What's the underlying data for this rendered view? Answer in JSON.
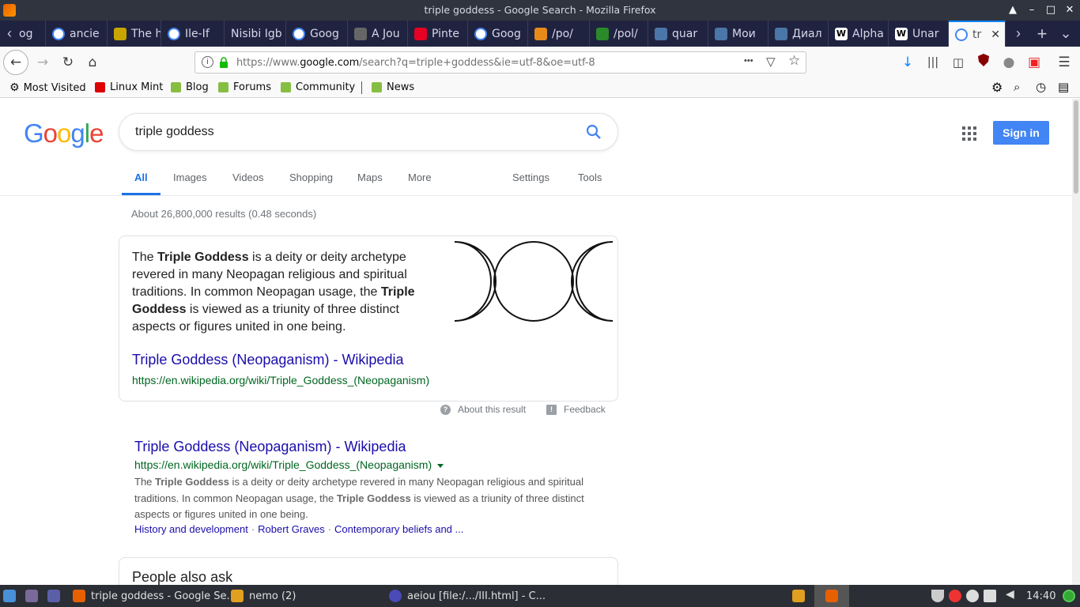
{
  "window": {
    "title": "triple goddess - Google Search - Mozilla Firefox",
    "minimize": "▲",
    "restore": "–",
    "maximize": "□",
    "close": "✕"
  },
  "tabs": [
    {
      "label": "og",
      "icon": "firefox-icon",
      "color": "#555"
    },
    {
      "label": "ancie",
      "icon": "google-icon",
      "color": "#4285f4"
    },
    {
      "label": "The h",
      "icon": "favicon-f-icon",
      "color": "#c7a400"
    },
    {
      "label": "Ile-If",
      "icon": "google-icon",
      "color": "#4285f4"
    },
    {
      "label": "Nisibi Igb",
      "icon": "none",
      "color": ""
    },
    {
      "label": "Goog",
      "icon": "google-icon",
      "color": "#4285f4"
    },
    {
      "label": "A Jou",
      "icon": "key-icon",
      "color": "#666"
    },
    {
      "label": "Pinte",
      "icon": "pinterest-icon",
      "color": "#e60023"
    },
    {
      "label": "Goog",
      "icon": "google-icon",
      "color": "#4285f4"
    },
    {
      "label": "/po/",
      "icon": "bolt-icon",
      "color": "#e88a1a"
    },
    {
      "label": "/pol/",
      "icon": "clover-icon",
      "color": "#2a8a2a"
    },
    {
      "label": "quar",
      "icon": "vk-icon",
      "color": "#4a76a8"
    },
    {
      "label": "Мои",
      "icon": "vk-icon",
      "color": "#4a76a8"
    },
    {
      "label": "Диал",
      "icon": "chat-icon",
      "color": "#4a76a8"
    },
    {
      "label": "Alpha",
      "icon": "wikipedia-icon",
      "color": "#fff"
    },
    {
      "label": "Unar",
      "icon": "wikipedia-icon",
      "color": "#fff"
    },
    {
      "label": "tr",
      "icon": "google-icon",
      "color": "#4285f4"
    }
  ],
  "tab_controls": {
    "scroll_left": "‹",
    "scroll_right": "›",
    "new_tab": "+",
    "list": "⌄",
    "close_active": "✕"
  },
  "navbar": {
    "back": "←",
    "forward": "→",
    "reload": "↻",
    "home": "⌂",
    "url_prefix": "https://www.",
    "url_domain": "google.com",
    "url_rest": "/search?q=triple+goddess&ie=utf-8&oe=utf-8",
    "page_actions": "•••",
    "menu": "☰"
  },
  "bookmarks": [
    {
      "label": "Most Visited",
      "icon": "gear-icon"
    },
    {
      "label": "Linux Mint",
      "icon": "linux-mint-icon"
    },
    {
      "label": "Blog",
      "icon": "mint-icon"
    },
    {
      "label": "Forums",
      "icon": "mint-icon"
    },
    {
      "label": "Community",
      "icon": "mint-icon"
    },
    {
      "label": "News",
      "icon": "mint-icon"
    }
  ],
  "google": {
    "logo_letters": [
      "G",
      "o",
      "o",
      "g",
      "l",
      "e"
    ],
    "logo_colors": [
      "#4285f4",
      "#ea4335",
      "#fbbc05",
      "#4285f4",
      "#34a853",
      "#ea4335"
    ],
    "query": "triple goddess",
    "signin": "Sign in",
    "tabs": [
      "All",
      "Images",
      "Videos",
      "Shopping",
      "Maps",
      "More"
    ],
    "tools": [
      "Settings",
      "Tools"
    ],
    "stats": "About 26,800,000 results (0.48 seconds)"
  },
  "featured": {
    "desc_parts": [
      {
        "t": "The ",
        "b": false
      },
      {
        "t": "Triple Goddess",
        "b": true
      },
      {
        "t": " is a deity or deity archetype revered in many Neopagan religious and spiritual traditions. In common Neopagan usage, the ",
        "b": false
      },
      {
        "t": "Triple Goddess",
        "b": true
      },
      {
        "t": " is viewed as a triunity of three distinct aspects or figures united in one being.",
        "b": false
      }
    ],
    "title": "Triple Goddess (Neopaganism) - Wikipedia",
    "url": "https://en.wikipedia.org/wiki/Triple_Goddess_(Neopaganism)",
    "about": "About this result",
    "feedback": "Feedback"
  },
  "result": {
    "title": "Triple Goddess (Neopaganism) - Wikipedia",
    "url": "https://en.wikipedia.org/wiki/Triple_Goddess_(Neopaganism)",
    "snippet_parts": [
      {
        "t": "The ",
        "b": false
      },
      {
        "t": "Triple Goddess",
        "b": true
      },
      {
        "t": " is a deity or deity archetype revered in many Neopagan religious and spiritual traditions. In common Neopagan usage, the ",
        "b": false
      },
      {
        "t": "Triple Goddess",
        "b": true
      },
      {
        "t": " is viewed as a triunity of three distinct aspects or figures united in one being.",
        "b": false
      }
    ],
    "sitelinks": [
      "History and development",
      "Robert Graves",
      "Contemporary beliefs and ..."
    ]
  },
  "people_also_ask": "People also ask",
  "taskbar": {
    "windows": [
      {
        "label": "triple goddess - Google Se...",
        "icon": "firefox-icon"
      },
      {
        "label": "nemo (2)",
        "icon": "folder-icon"
      },
      {
        "label": "aeiou [file:/.../III.html] - C...",
        "icon": "app-icon"
      }
    ],
    "clock": "14:40"
  }
}
